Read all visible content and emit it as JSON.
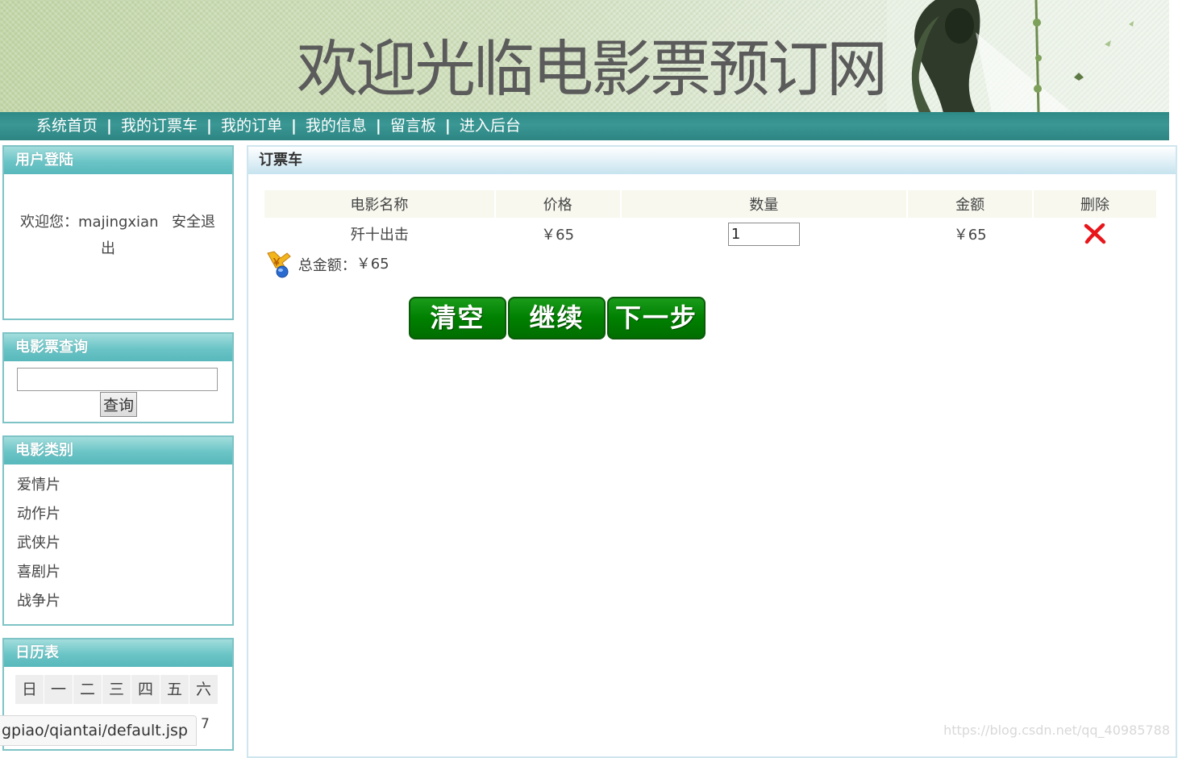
{
  "header": {
    "title": "欢迎光临电影票预订网"
  },
  "nav": {
    "items": [
      "系统首页",
      "我的订票车",
      "我的订单",
      "我的信息",
      "留言板",
      "进入后台"
    ],
    "separator": "|"
  },
  "login": {
    "heading": "用户登陆",
    "welcome": "欢迎您：majingxian",
    "logout_part1": "安全退",
    "logout_part2": "出"
  },
  "search": {
    "heading": "电影票查询",
    "input_value": "",
    "button_label": "查询"
  },
  "categories": {
    "heading": "电影类别",
    "items": [
      "爱情片",
      "动作片",
      "武侠片",
      "喜剧片",
      "战争片"
    ]
  },
  "calendar": {
    "heading": "日历表",
    "weekdays": [
      "日",
      "一",
      "二",
      "三",
      "四",
      "五",
      "六"
    ],
    "first_visible_day": "7"
  },
  "cart": {
    "heading": "订票车",
    "columns": [
      "电影名称",
      "价格",
      "数量",
      "金额",
      "删除"
    ],
    "rows": [
      {
        "name": "歼十出击",
        "price": "￥65",
        "quantity": "1",
        "amount": "￥65"
      }
    ],
    "total_label": "总金额：",
    "total_value": "￥65",
    "buttons": {
      "clear": "清空",
      "continue": "继续",
      "next": "下一步"
    }
  },
  "status_bar": {
    "url": "gpiao/qiantai/default.jsp"
  },
  "watermark": "https://blog.csdn.net/qq_40985788",
  "colors": {
    "nav_bg": "#2e8a87",
    "box_header": "#6ac4c6",
    "box_border": "#7ec3c6",
    "button_green": "#008000",
    "delete_red": "#e8161b"
  }
}
